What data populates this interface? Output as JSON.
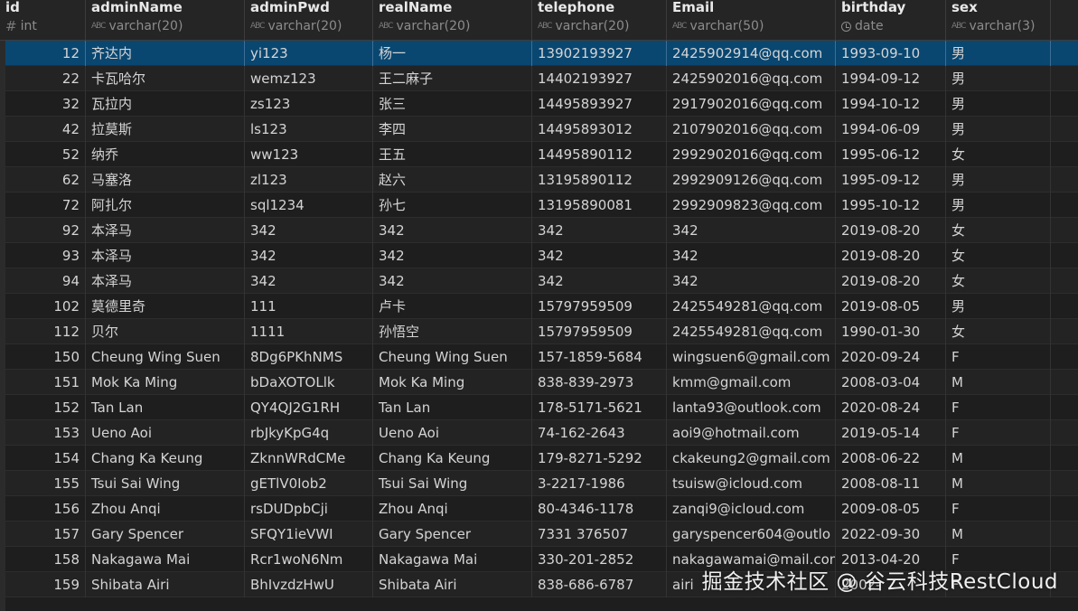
{
  "columns": [
    {
      "key": "id",
      "name": "id",
      "type": "int",
      "icon": "number-hash-icon"
    },
    {
      "key": "adminName",
      "name": "adminName",
      "type": "varchar(20)",
      "icon": "text-abc-icon"
    },
    {
      "key": "adminPwd",
      "name": "adminPwd",
      "type": "varchar(20)",
      "icon": "text-abc-icon"
    },
    {
      "key": "realName",
      "name": "realName",
      "type": "varchar(20)",
      "icon": "text-abc-icon"
    },
    {
      "key": "telephone",
      "name": "telephone",
      "type": "varchar(20)",
      "icon": "text-abc-icon"
    },
    {
      "key": "Email",
      "name": "Email",
      "type": "varchar(50)",
      "icon": "text-abc-icon"
    },
    {
      "key": "birthday",
      "name": "birthday",
      "type": "date",
      "icon": "clock-icon"
    },
    {
      "key": "sex",
      "name": "sex",
      "type": "varchar(3)",
      "icon": "text-abc-icon"
    }
  ],
  "selected_row": 0,
  "rows": [
    [
      "12",
      "齐达内",
      "yi123",
      "杨一",
      "13902193927",
      "2425902914@qq.com",
      "1993-09-10",
      "男"
    ],
    [
      "22",
      "卡瓦哈尔",
      "wemz123",
      "王二麻子",
      "14402193927",
      "2425902016@qq.com",
      "1994-09-12",
      "男"
    ],
    [
      "32",
      "瓦拉内",
      "zs123",
      "张三",
      "14495893927",
      "2917902016@qq.com",
      "1994-10-12",
      "男"
    ],
    [
      "42",
      "拉莫斯",
      "ls123",
      "李四",
      "14495893012",
      "2107902016@qq.com",
      "1994-06-09",
      "男"
    ],
    [
      "52",
      "纳乔",
      "ww123",
      "王五",
      "14495890112",
      "2992902016@qq.com",
      "1995-06-12",
      "女"
    ],
    [
      "62",
      "马塞洛",
      "zl123",
      "赵六",
      "13195890112",
      "2992909126@qq.com",
      "1995-09-12",
      "男"
    ],
    [
      "72",
      "阿扎尔",
      "sql1234",
      "孙七",
      "13195890081",
      "2992909823@qq.com",
      "1995-10-12",
      "男"
    ],
    [
      "92",
      "本泽马",
      "342",
      "342",
      "342",
      "342",
      "2019-08-20",
      "女"
    ],
    [
      "93",
      "本泽马",
      "342",
      "342",
      "342",
      "342",
      "2019-08-20",
      "女"
    ],
    [
      "94",
      "本泽马",
      "342",
      "342",
      "342",
      "342",
      "2019-08-20",
      "女"
    ],
    [
      "102",
      "莫德里奇",
      "111",
      "卢卡",
      "15797959509",
      "2425549281@qq.com",
      "2019-08-05",
      "男"
    ],
    [
      "112",
      "贝尔",
      "1111",
      "孙悟空",
      "15797959509",
      "2425549281@qq.com",
      "1990-01-30",
      "女"
    ],
    [
      "150",
      "Cheung Wing Suen",
      "8Dg6PKhNMS",
      "Cheung Wing Suen",
      "157-1859-5684",
      "wingsuen6@gmail.com",
      "2020-09-24",
      "F"
    ],
    [
      "151",
      "Mok Ka Ming",
      "bDaXOTOLlk",
      "Mok Ka Ming",
      "838-839-2973",
      "kmm@gmail.com",
      "2008-03-04",
      "M"
    ],
    [
      "152",
      "Tan Lan",
      "QY4QJ2G1RH",
      "Tan Lan",
      "178-5171-5621",
      "lanta93@outlook.com",
      "2020-08-24",
      "F"
    ],
    [
      "153",
      "Ueno Aoi",
      "rbJkyKpG4q",
      "Ueno Aoi",
      "74-162-2643",
      "aoi9@hotmail.com",
      "2019-05-14",
      "F"
    ],
    [
      "154",
      "Chang Ka Keung",
      "ZknnWRdCMe",
      "Chang Ka Keung",
      "179-8271-5292",
      "ckakeung2@gmail.com",
      "2008-06-22",
      "M"
    ],
    [
      "155",
      "Tsui Sai Wing",
      "gETlV0Iob2",
      "Tsui Sai Wing",
      "3-2217-1986",
      "tsuisw@icloud.com",
      "2008-08-11",
      "M"
    ],
    [
      "156",
      "Zhou Anqi",
      "rsDUDpbCji",
      "Zhou Anqi",
      "80-4346-1178",
      "zanqi9@icloud.com",
      "2009-08-05",
      "F"
    ],
    [
      "157",
      "Gary Spencer",
      "SFQY1ieVWI",
      "Gary Spencer",
      "7331 376507",
      "garyspencer604@outlo",
      "2022-09-30",
      "M"
    ],
    [
      "158",
      "Nakagawa Mai",
      "Rcr1woN6Nm",
      "Nakagawa Mai",
      "330-201-2852",
      "nakagawamai@mail.com",
      "2013-04-20",
      "F"
    ],
    [
      "159",
      "Shibata Airi",
      "BhIvzdzHwU",
      "Shibata Airi",
      "838-686-6787",
      "airi",
      "2002-",
      "F"
    ]
  ],
  "watermark": "掘金技术社区 @ 谷云科技RestCloud"
}
